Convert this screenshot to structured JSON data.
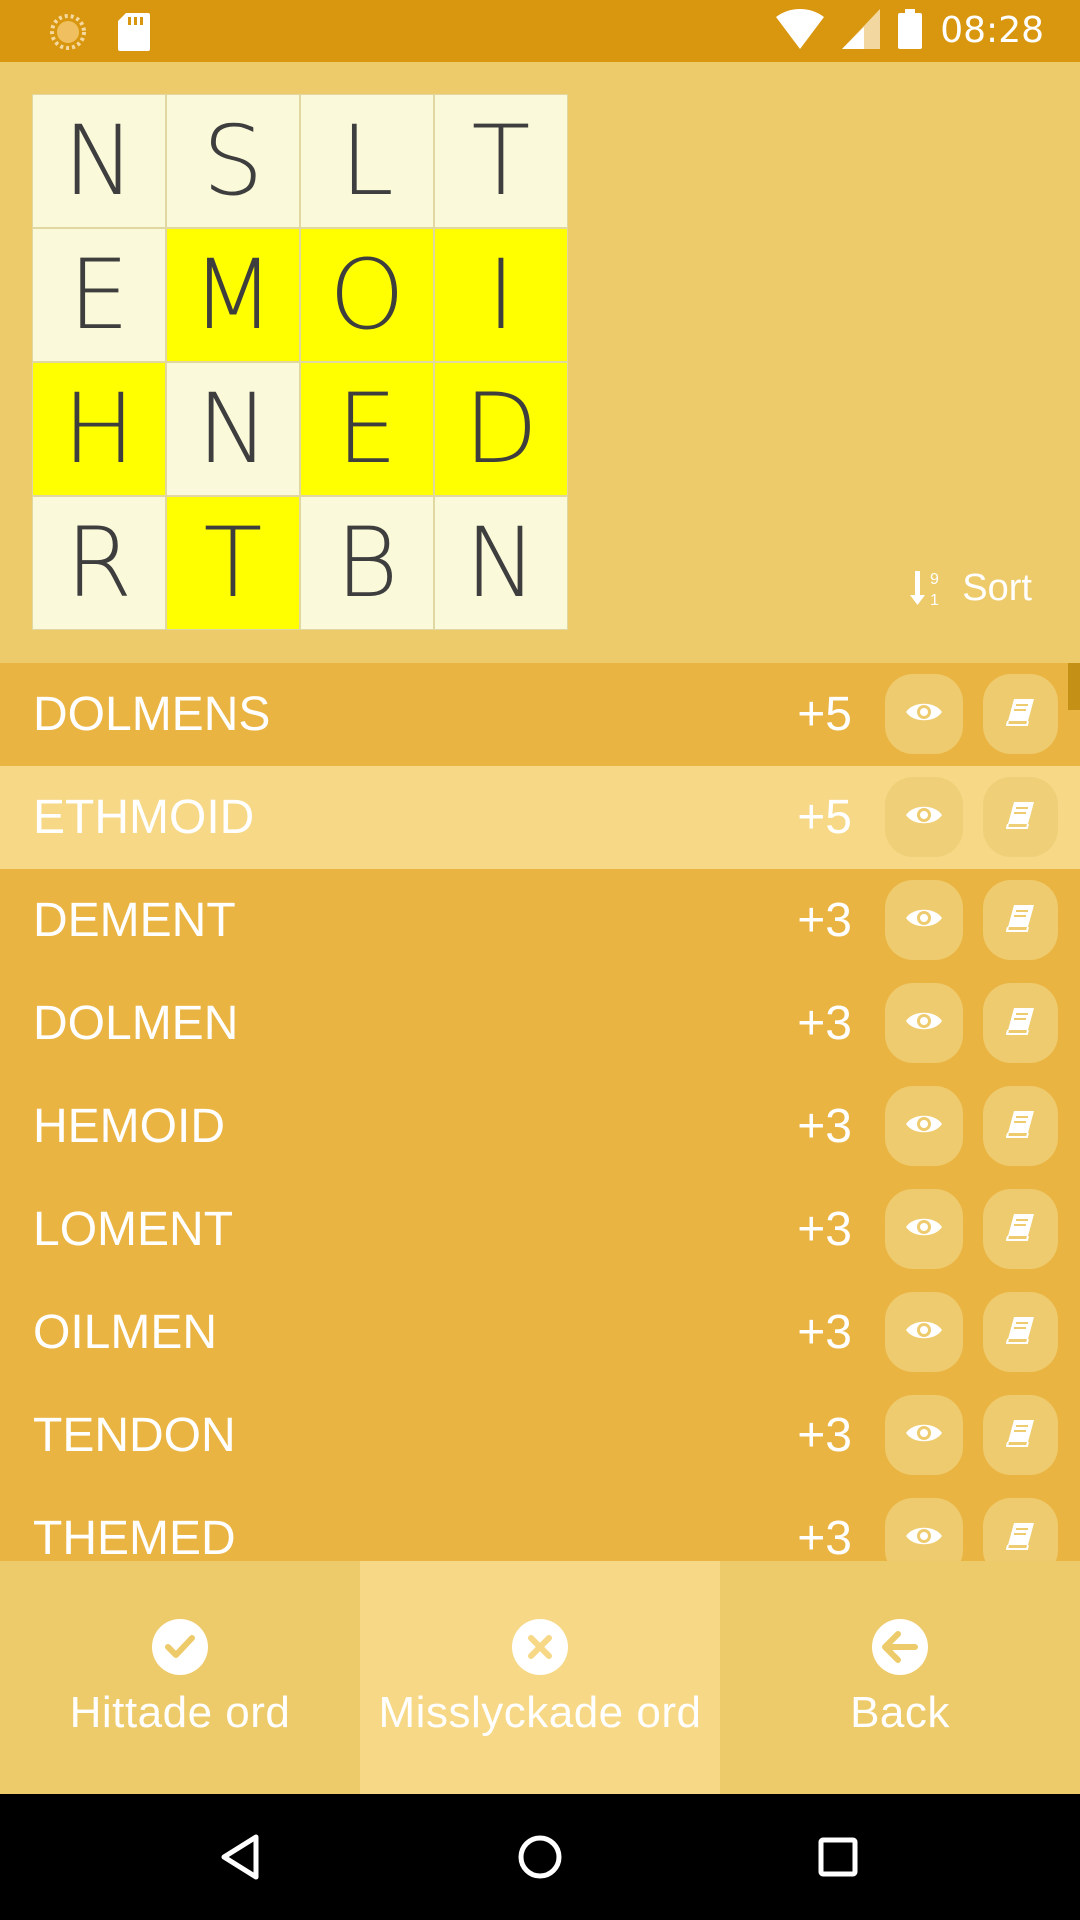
{
  "status_bar": {
    "time": "08:28",
    "icons": [
      "loading-icon",
      "sd-card-icon",
      "wifi-icon",
      "cellular-signal-icon",
      "battery-icon"
    ]
  },
  "board": {
    "rows": [
      [
        {
          "letter": "N",
          "highlighted": false
        },
        {
          "letter": "S",
          "highlighted": false
        },
        {
          "letter": "L",
          "highlighted": false
        },
        {
          "letter": "T",
          "highlighted": false
        }
      ],
      [
        {
          "letter": "E",
          "highlighted": false
        },
        {
          "letter": "M",
          "highlighted": true
        },
        {
          "letter": "O",
          "highlighted": true
        },
        {
          "letter": "I",
          "highlighted": true
        }
      ],
      [
        {
          "letter": "H",
          "highlighted": true
        },
        {
          "letter": "N",
          "highlighted": false
        },
        {
          "letter": "E",
          "highlighted": true
        },
        {
          "letter": "D",
          "highlighted": true
        }
      ],
      [
        {
          "letter": "R",
          "highlighted": false
        },
        {
          "letter": "T",
          "highlighted": true
        },
        {
          "letter": "B",
          "highlighted": false
        },
        {
          "letter": "N",
          "highlighted": false
        }
      ]
    ],
    "highlight_color": "#FFFF00",
    "cell_color": "#FAF9D9"
  },
  "sort": {
    "label": "Sort",
    "icon": "sort-numeric-icon"
  },
  "words": [
    {
      "word": "DOLMENS",
      "points": "+5",
      "selected": false
    },
    {
      "word": "ETHMOID",
      "points": "+5",
      "selected": true
    },
    {
      "word": "DEMENT",
      "points": "+3",
      "selected": false
    },
    {
      "word": "DOLMEN",
      "points": "+3",
      "selected": false
    },
    {
      "word": "HEMOID",
      "points": "+3",
      "selected": false
    },
    {
      "word": "LOMENT",
      "points": "+3",
      "selected": false
    },
    {
      "word": "OILMEN",
      "points": "+3",
      "selected": false
    },
    {
      "word": "TENDON",
      "points": "+3",
      "selected": false
    },
    {
      "word": "THEMED",
      "points": "+3",
      "selected": false
    }
  ],
  "bottom_tabs": [
    {
      "label": "Hittade ord",
      "icon": "check-circle-icon",
      "active": false
    },
    {
      "label": "Misslyckade ord",
      "icon": "x-circle-icon",
      "active": true
    },
    {
      "label": "Back",
      "icon": "arrow-left-circle-icon",
      "active": false
    }
  ],
  "colors": {
    "status_bar": "#D8970E",
    "background": "#EDCB6B",
    "list_background": "#EAB443",
    "selected_row": "#F6D886",
    "nav_bar": "#000000"
  }
}
